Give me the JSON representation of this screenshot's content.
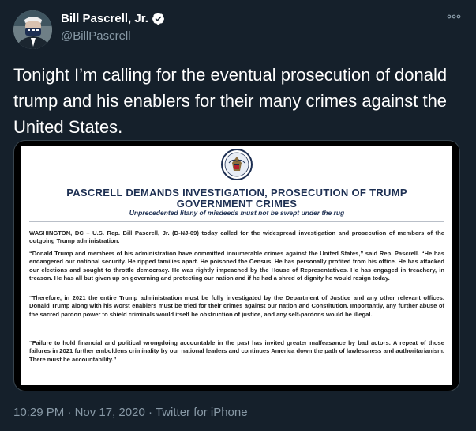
{
  "author": {
    "name": "Bill Pascrell, Jr.",
    "handle": "@BillPascrell",
    "avatar_icon": "profile-photo-icon",
    "verified_icon": "verified-badge-icon",
    "verified_color": "#1da1f2"
  },
  "more_icon": "more-options-icon",
  "tweet": {
    "text": "Tonight I’m calling for the eventual prosecution of donald trump and his enablers for their many crimes against the United States."
  },
  "document": {
    "seal_icon": "congressional-seal-icon",
    "title_line1": "PASCRELL DEMANDS INVESTIGATION,  PROSECUTION OF TRUMP",
    "title_line2": "GOVERNMENT CRIMES",
    "subtitle": "Unprecedented litany of misdeeds must not be swept under the rug",
    "paragraphs": [
      "WASHINGTON, DC – U.S. Rep. Bill Pascrell, Jr. (D-NJ-09) today called for the widespread investigation and prosecution of members of the outgoing Trump administration.",
      "“Donald Trump and members of his administration have committed innumerable crimes against the United States,” said Rep. Pascrell. “He has endangered our national security. He ripped families apart. He poisoned the Census. He has personally profited from his office. He has attacked our elections and sought to throttle democracy. He was rightly impeached by the House of Representatives. He has engaged in treachery, in treason. He has all but given up on governing and protecting our nation and if he had a shred of dignity he would resign today.",
      "“Therefore, in 2021 the entire Trump administration must be fully investigated by the Department of Justice and any other relevant offices. Donald Trump along with his worst enablers must be tried for their crimes against our nation and Constitution. Importantly, any further abuse of the sacred pardon power to shield criminals would itself be obstruction of justice, and any self-pardons would be illegal.",
      "“Failure to hold financial and political wrongdoing accountable in the past has invited greater malfeasance by bad actors. A repeat of those failures in 2021 further emboldens criminality by our national leaders and continues America down the path of lawlessness and authoritarianism. There must be accountability.”"
    ]
  },
  "footer": {
    "time": "10:29 PM",
    "separator1": " · ",
    "date": "Nov 17, 2020",
    "separator2": " · ",
    "source": "Twitter for iPhone"
  }
}
